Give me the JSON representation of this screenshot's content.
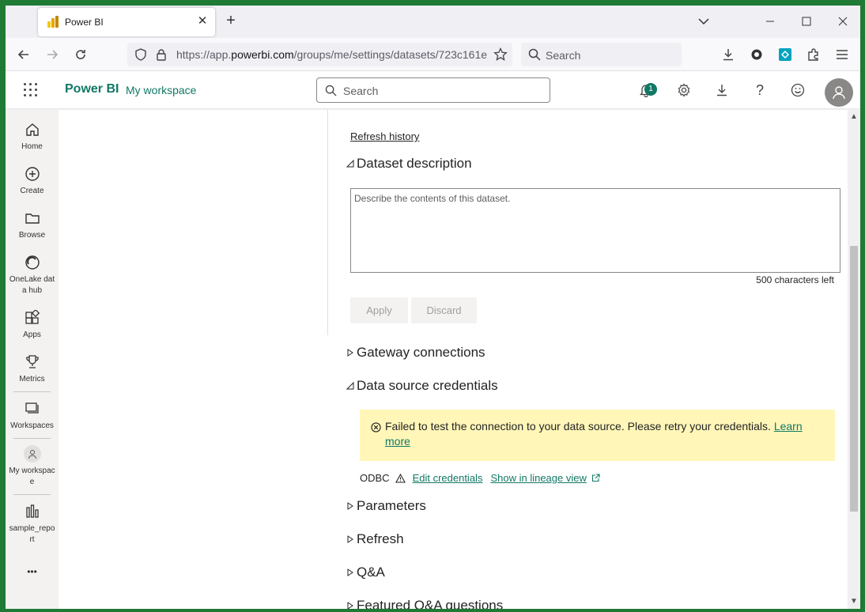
{
  "browser": {
    "tab_title": "Power BI",
    "url_prefix": "https://app.",
    "url_domain": "powerbi.com",
    "url_path": "/groups/me/settings/datasets/723c161e",
    "search_placeholder": "Search",
    "brand_colors": {
      "accent": "#117865",
      "frame": "#1e7a34"
    }
  },
  "header": {
    "brand": "Power BI",
    "workspace": "My workspace",
    "search_placeholder": "Search",
    "notification_count": "1"
  },
  "leftnav": {
    "items": [
      {
        "label": "Home",
        "icon": "home-icon"
      },
      {
        "label": "Create",
        "icon": "plus-circle-icon"
      },
      {
        "label": "Browse",
        "icon": "folder-icon"
      },
      {
        "label": "OneLake data hub",
        "icon": "onelake-icon"
      },
      {
        "label": "Apps",
        "icon": "apps-icon"
      },
      {
        "label": "Metrics",
        "icon": "trophy-icon"
      },
      {
        "label": "Workspaces",
        "icon": "workspaces-icon"
      },
      {
        "label": "My workspace",
        "icon": "person-icon"
      },
      {
        "label": "sample_report",
        "icon": "report-icon"
      }
    ],
    "more": "•••"
  },
  "content": {
    "refresh_history": "Refresh history",
    "dataset_description": {
      "title": "Dataset description",
      "placeholder": "Describe the contents of this dataset.",
      "chars_left": "500 characters left",
      "apply": "Apply",
      "discard": "Discard"
    },
    "gateway_connections": "Gateway connections",
    "data_source_credentials": {
      "title": "Data source credentials",
      "warning": "Failed to test the connection to your data source. Please retry your credentials.",
      "learn_more": "Learn more",
      "source": "ODBC",
      "edit_credentials": "Edit credentials",
      "lineage_view": "Show in lineage view"
    },
    "parameters": "Parameters",
    "refresh": "Refresh",
    "qa": "Q&A",
    "featured_qa": "Featured Q&A questions"
  }
}
